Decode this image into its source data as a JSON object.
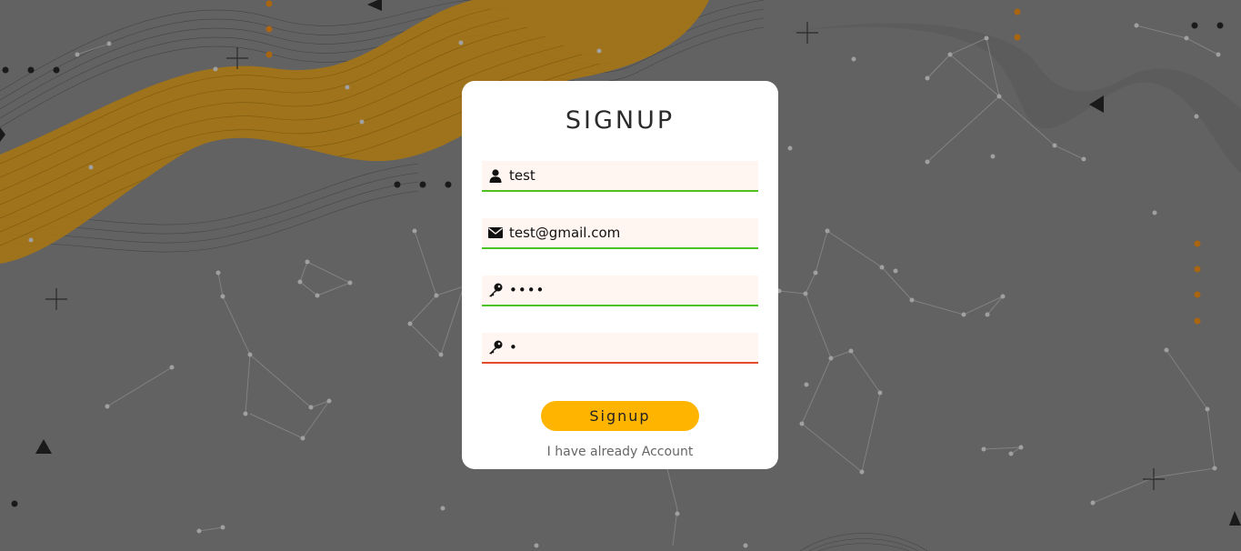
{
  "form": {
    "title": "SIGNUP",
    "username": {
      "value": "test",
      "icon": "user-icon",
      "status": "valid"
    },
    "email": {
      "value": "test@gmail.com",
      "icon": "envelope-icon",
      "status": "valid"
    },
    "password": {
      "value": "abcd",
      "icon": "key-icon",
      "status": "valid"
    },
    "confirm_password": {
      "value": "a",
      "icon": "key-icon",
      "status": "invalid"
    },
    "submit_label": "Signup",
    "login_link": "I have already Account"
  },
  "colors": {
    "background": "#626262",
    "card": "#ffffff",
    "field_bg": "#fff6f2",
    "valid": "#4cc322",
    "invalid": "#e34b2a",
    "button": "#ffb400",
    "accent_wave": "#a9770f"
  }
}
